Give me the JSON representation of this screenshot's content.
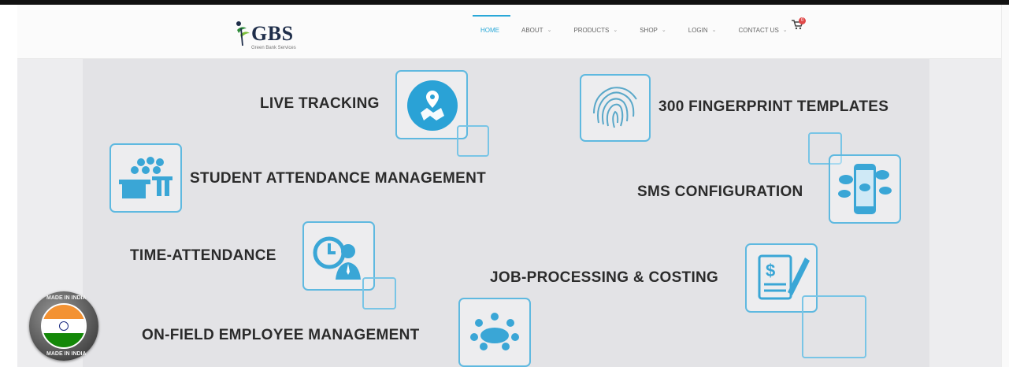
{
  "logo": {
    "text": "GBS",
    "subtitle": "Green Bank Services"
  },
  "nav": {
    "items": [
      {
        "label": "HOME",
        "active": true,
        "has_dropdown": false
      },
      {
        "label": "ABOUT",
        "active": false,
        "has_dropdown": true
      },
      {
        "label": "PRODUCTS",
        "active": false,
        "has_dropdown": true
      },
      {
        "label": "SHOP",
        "active": false,
        "has_dropdown": true
      },
      {
        "label": "LOGIN",
        "active": false,
        "has_dropdown": true
      },
      {
        "label": "CONTACT US",
        "active": false,
        "has_dropdown": true
      }
    ],
    "cart_icon": "cart-icon",
    "cart_count": "0"
  },
  "features": {
    "live_tracking": "LIVE TRACKING",
    "fingerprint": "300 FINGERPRINT TEMPLATES",
    "student_attendance": "STUDENT ATTENDANCE MANAGEMENT",
    "sms": "SMS CONFIGURATION",
    "time_attendance": "TIME-ATTENDANCE",
    "job_processing": "JOB-PROCESSING & COSTING",
    "on_field": "ON-FIELD EMPLOYEE MANAGEMENT"
  },
  "badge": {
    "top_text": "MADE IN INDIA",
    "bottom_text": "MADE IN INDIA"
  },
  "colors": {
    "accent": "#2aa8d8",
    "box_border": "#5fb9e0",
    "text": "#2b2b2b",
    "hero_bg": "#e3e3e6"
  }
}
